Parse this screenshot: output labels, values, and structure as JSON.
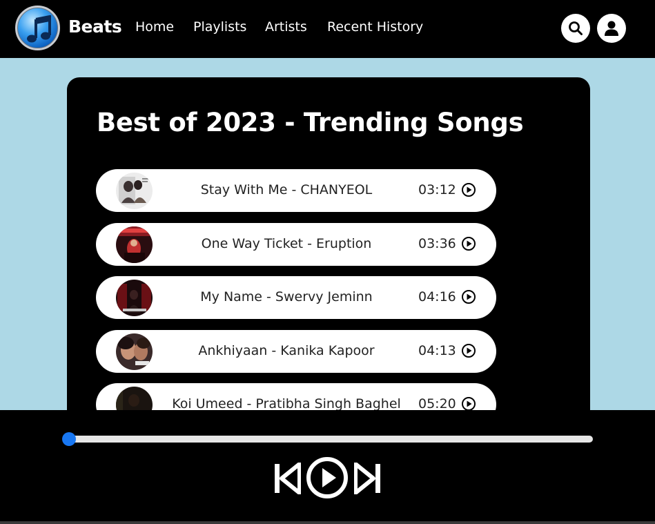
{
  "header": {
    "brand": "Beats",
    "logo_icon": "music-note-icon",
    "nav": [
      {
        "label": "Home"
      },
      {
        "label": "Playlists"
      },
      {
        "label": "Artists"
      },
      {
        "label": "Recent History"
      }
    ],
    "search_icon": "search-icon",
    "user_icon": "user-icon"
  },
  "playlist": {
    "title": "Best of 2023 - Trending Songs",
    "songs": [
      {
        "title": "Stay With Me - CHANYEOL",
        "duration": "03:12"
      },
      {
        "title": "One Way Ticket - Eruption",
        "duration": "03:36"
      },
      {
        "title": "My Name - Swervy Jeminn",
        "duration": "04:16"
      },
      {
        "title": "Ankhiyaan - Kanika Kapoor",
        "duration": "04:13"
      },
      {
        "title": "Koi Umeed - Pratibha Singh Baghel",
        "duration": "05:20"
      }
    ]
  },
  "player": {
    "progress_fraction": 0.0,
    "colors": {
      "accent": "#1877f2",
      "track": "#e6e6e6",
      "background": "#000000",
      "page_background": "#add8e6"
    },
    "controls": [
      "previous-icon",
      "play-icon",
      "next-icon"
    ]
  }
}
